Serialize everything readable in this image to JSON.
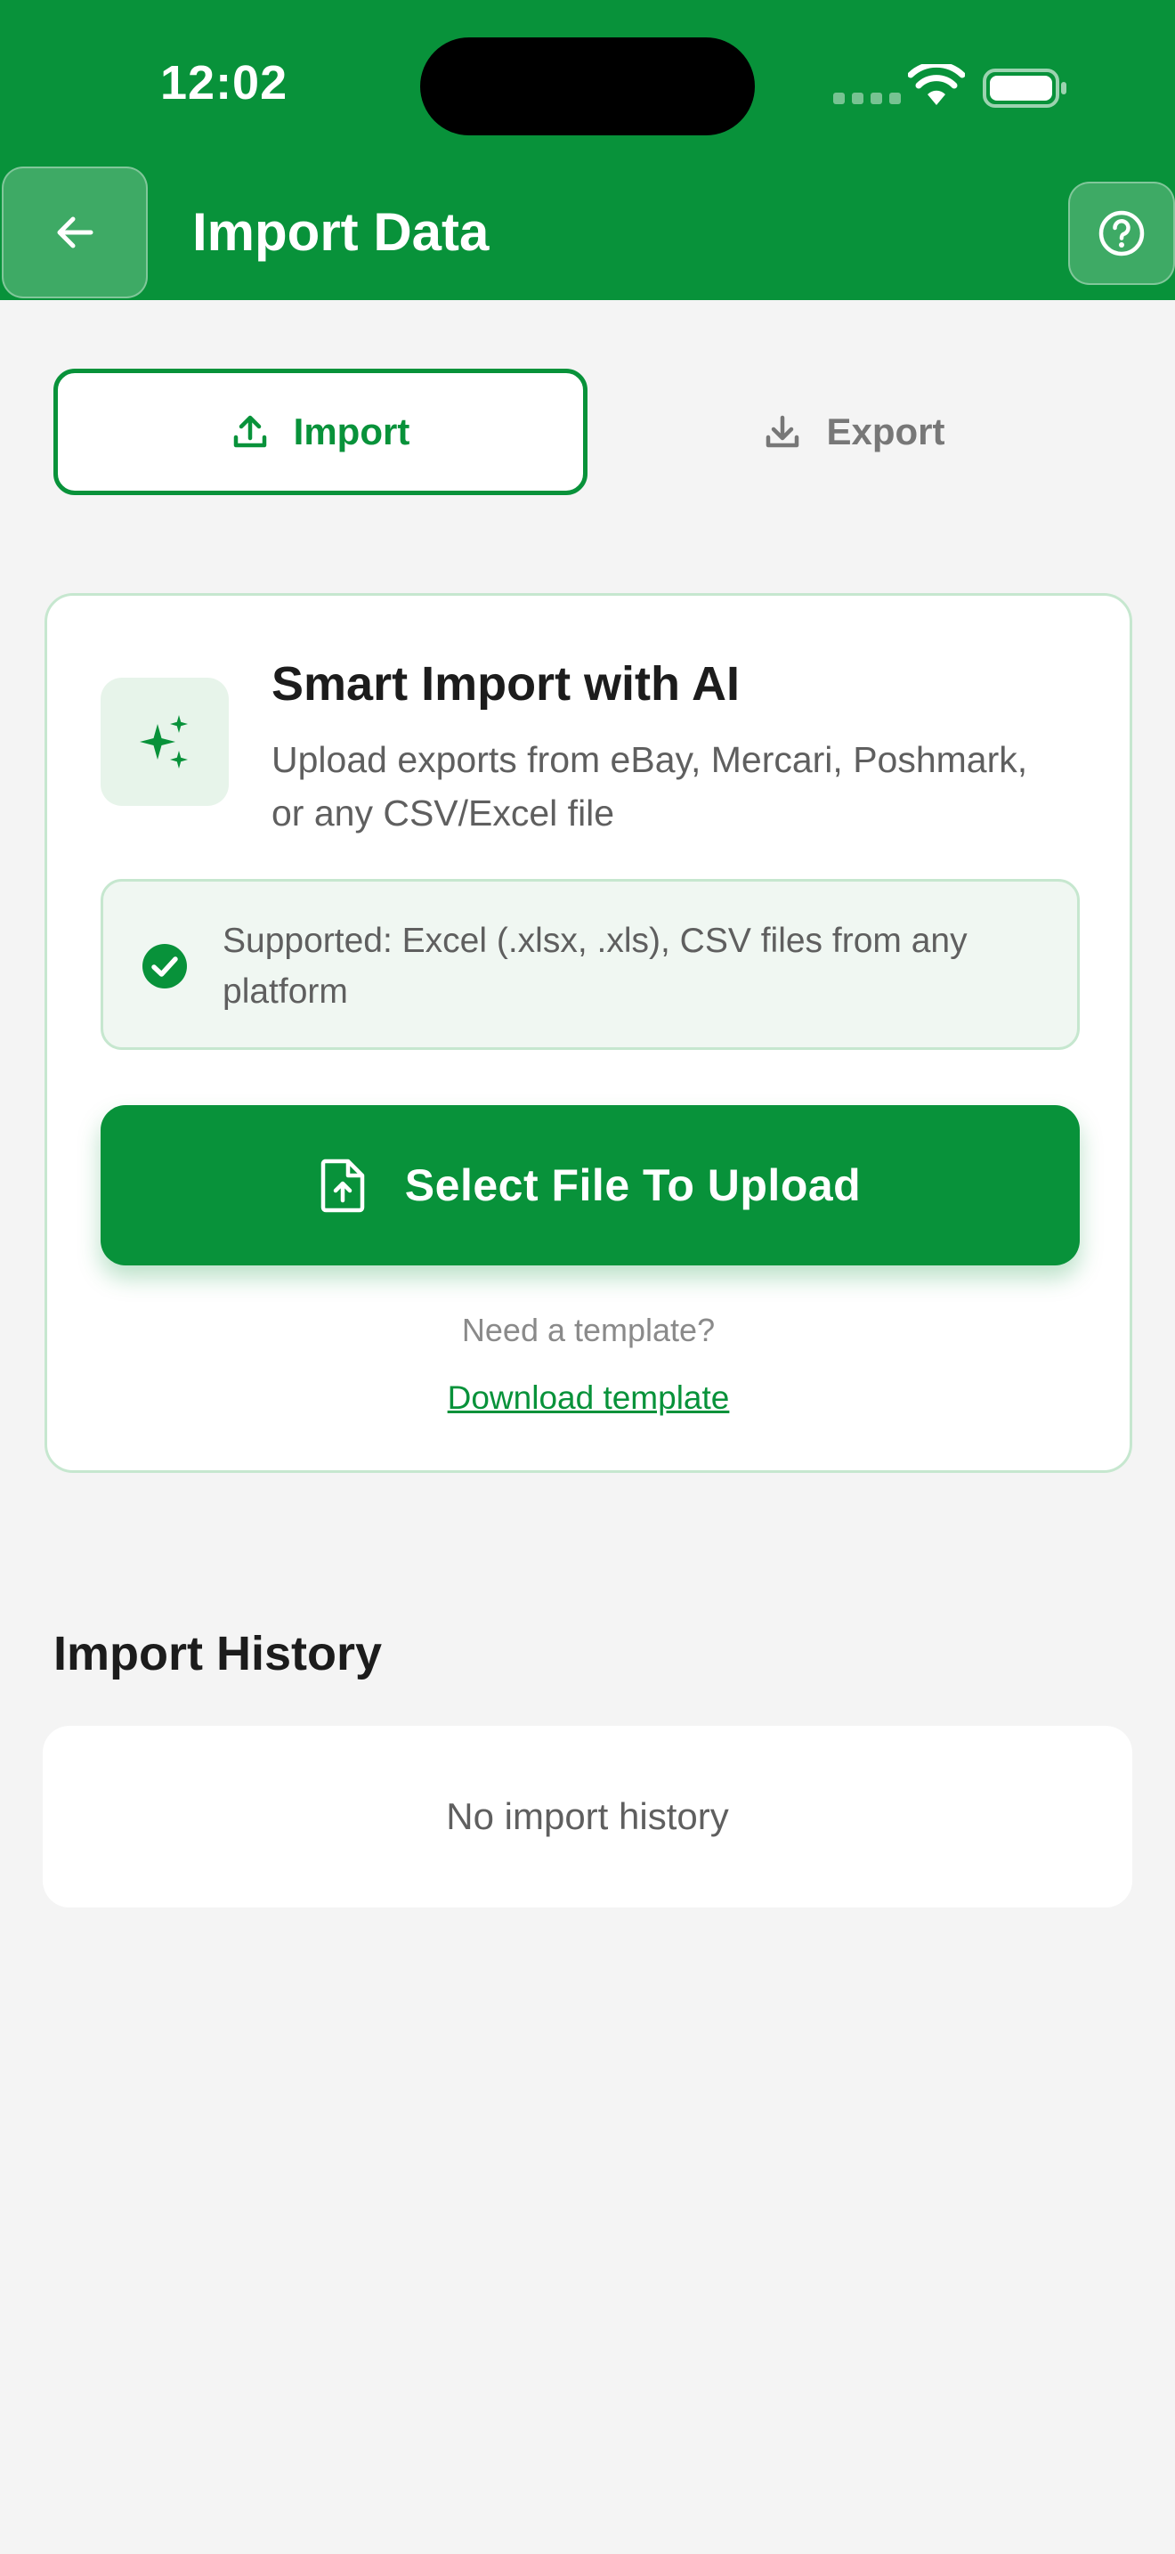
{
  "status_bar": {
    "time": "12:02"
  },
  "header": {
    "title": "Import Data"
  },
  "tabs": [
    {
      "label": "Import",
      "icon": "upload-icon",
      "active": true
    },
    {
      "label": "Export",
      "icon": "download-icon",
      "active": false
    }
  ],
  "import_card": {
    "icon": "sparkles-icon",
    "title": "Smart Import with AI",
    "subtitle": "Upload exports from eBay, Mercari, Poshmark, or any CSV/Excel file",
    "supported_text": "Supported: Excel (.xlsx, .xls), CSV files from any platform",
    "upload_button_label": "Select File To Upload",
    "template_prompt": "Need a template?",
    "template_link": "Download template"
  },
  "history": {
    "title": "Import History",
    "empty_text": "No import history"
  },
  "colors": {
    "brand_green": "#08923a",
    "light_green": "#e7f4ea",
    "border_green": "#c6e7cf",
    "background": "#f4f4f4"
  }
}
